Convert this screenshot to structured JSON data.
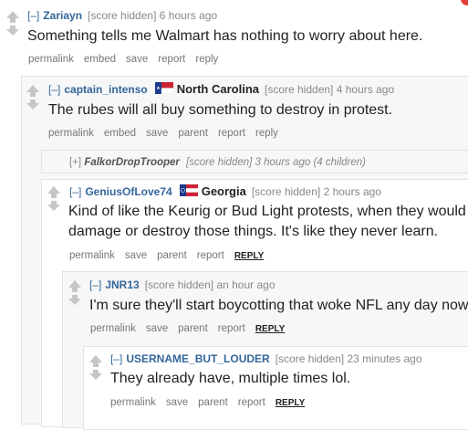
{
  "comments": [
    {
      "expand": "[–]",
      "author": "Zariayn",
      "score": "[score hidden]",
      "time": "6 hours ago",
      "text": "Something tells me Walmart has nothing to worry about here.",
      "buttons": [
        "permalink",
        "embed",
        "save",
        "report",
        "reply"
      ]
    },
    {
      "expand": "[–]",
      "author": "captain_intenso",
      "flair": "North Carolina",
      "score": "[score hidden]",
      "time": "4 hours ago",
      "text": "The rubes will all buy something to destroy in protest.",
      "buttons": [
        "permalink",
        "embed",
        "save",
        "parent",
        "report",
        "reply"
      ]
    },
    {
      "expand": "[+]",
      "author": "FalkorDropTrooper",
      "score": "[score hidden]",
      "meta": "3 hours ago (4 children)"
    },
    {
      "expand": "[–]",
      "author": "GeniusOfLove74",
      "flair": "Georgia",
      "score": "[score hidden]",
      "time": "2 hours ago",
      "text_line1": "Kind of like the Keurig or Bud Light protests, when they would",
      "text_line2": "damage or destroy those things. It's like they never learn.",
      "buttons": [
        "permalink",
        "save",
        "parent",
        "report"
      ],
      "reply": "REPLY"
    },
    {
      "expand": "[–]",
      "author": "JNR13",
      "score": "[score hidden]",
      "time": "an hour ago",
      "text": "I'm sure they'll start boycotting that woke NFL any day now!",
      "buttons": [
        "permalink",
        "save",
        "parent",
        "report"
      ],
      "reply": "REPLY"
    },
    {
      "expand": "[–]",
      "author": "USERNAME_BUT_LOUDER",
      "score": "[score hidden]",
      "time": "23 minutes ago",
      "text": "They already have, multiple times lol.",
      "buttons": [
        "permalink",
        "save",
        "parent",
        "report"
      ],
      "reply": "REPLY"
    }
  ],
  "colors": {
    "author": "#336699",
    "meta": "#888888",
    "frame_bg": "#f7f7f8",
    "arrow": "#c6c6c6"
  }
}
